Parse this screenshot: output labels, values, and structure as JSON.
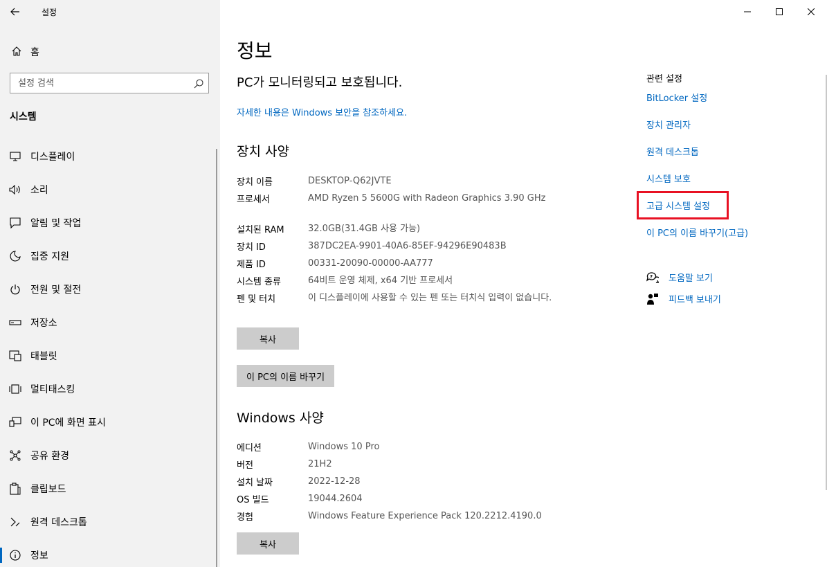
{
  "window": {
    "title": "설정"
  },
  "sidebar": {
    "home_label": "홈",
    "search_placeholder": "설정 검색",
    "section": "시스템",
    "items": [
      {
        "label": "디스플레이",
        "icon": "display-icon"
      },
      {
        "label": "소리",
        "icon": "speaker-icon"
      },
      {
        "label": "알림 및 작업",
        "icon": "notification-icon"
      },
      {
        "label": "집중 지원",
        "icon": "moon-icon"
      },
      {
        "label": "전원 및 절전",
        "icon": "power-icon"
      },
      {
        "label": "저장소",
        "icon": "storage-icon"
      },
      {
        "label": "태블릿",
        "icon": "tablet-icon"
      },
      {
        "label": "멀티태스킹",
        "icon": "multitasking-icon"
      },
      {
        "label": "이 PC에 화면 표시",
        "icon": "project-icon"
      },
      {
        "label": "공유 환경",
        "icon": "share-icon"
      },
      {
        "label": "클립보드",
        "icon": "clipboard-icon"
      },
      {
        "label": "원격 데스크톱",
        "icon": "remote-desktop-icon"
      },
      {
        "label": "정보",
        "icon": "info-icon",
        "active": true
      }
    ]
  },
  "main": {
    "title": "정보",
    "protected_text": "PC가 모니터링되고 보호됩니다.",
    "security_link": "자세한 내용은 Windows 보안을 참조하세요.",
    "device_specs": {
      "heading": "장치 사양",
      "rows": [
        {
          "key": "장치 이름",
          "value": "DESKTOP-Q62JVTE"
        },
        {
          "key": "프로세서",
          "value": "AMD Ryzen 5 5600G with Radeon Graphics 3.90 GHz"
        },
        {
          "key": "설치된 RAM",
          "value": "32.0GB(31.4GB 사용 가능)"
        },
        {
          "key": "장치 ID",
          "value": "387DC2EA-9901-40A6-85EF-94296E90483B"
        },
        {
          "key": "제품 ID",
          "value": "00331-20090-00000-AA777"
        },
        {
          "key": "시스템 종류",
          "value": "64비트 운영 체제, x64 기반 프로세서"
        },
        {
          "key": "펜 및 터치",
          "value": "이 디스플레이에 사용할 수 있는 펜 또는 터치식 입력이 없습니다."
        }
      ],
      "copy_button": "복사",
      "rename_button": "이 PC의 이름 바꾸기"
    },
    "windows_specs": {
      "heading": "Windows 사양",
      "rows": [
        {
          "key": "에디션",
          "value": "Windows 10 Pro"
        },
        {
          "key": "버전",
          "value": "21H2"
        },
        {
          "key": "설치 날짜",
          "value": "2022-12-28"
        },
        {
          "key": "OS 빌드",
          "value": "19044.2604"
        },
        {
          "key": "경험",
          "value": "Windows Feature Experience Pack 120.2212.4190.0"
        }
      ],
      "copy_button": "복사"
    }
  },
  "related": {
    "heading": "관련 설정",
    "links": [
      "BitLocker 설정",
      "장치 관리자",
      "원격 데스크톱",
      "시스템 보호",
      "고급 시스템 설정",
      "이 PC의 이름 바꾸기(고급)"
    ],
    "highlighted_index": 4,
    "help": [
      {
        "label": "도움말 보기",
        "icon": "help-chat-icon"
      },
      {
        "label": "피드백 보내기",
        "icon": "feedback-icon"
      }
    ]
  },
  "colors": {
    "accent": "#0067c0",
    "highlight": "#e81123",
    "sidebar_bg": "#f2f2f2",
    "button_bg": "#cccccc"
  }
}
